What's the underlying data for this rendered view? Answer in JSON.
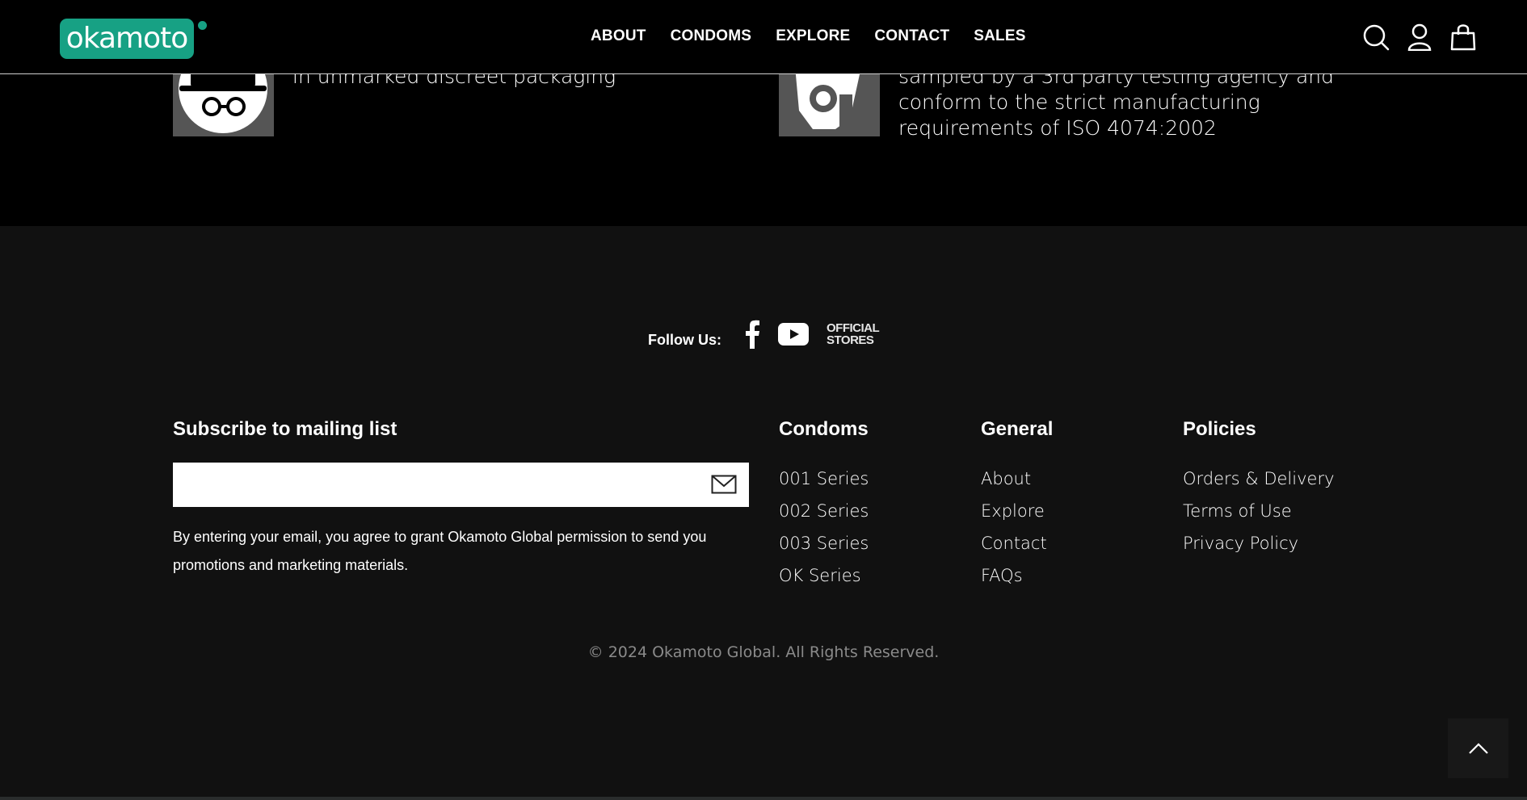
{
  "header": {
    "logo_text": "okamoto",
    "nav": [
      "ABOUT",
      "CONDOMS",
      "EXPLORE",
      "CONTACT",
      "SALES"
    ],
    "icons": [
      "search-icon",
      "account-icon",
      "cart-icon"
    ]
  },
  "features": [
    {
      "icon": "incognito-icon",
      "text": "in unmarked discreet packaging"
    },
    {
      "icon": "certification-icon",
      "text": "sampled by a 3rd party testing agency and conform to the strict manufacturing requirements of ISO 4074:2002"
    }
  ],
  "follow": {
    "label": "Follow Us:",
    "icons": [
      "facebook-icon",
      "youtube-icon"
    ],
    "official_line1": "OFFICIAL",
    "official_line2": "STORES"
  },
  "subscribe": {
    "title": "Subscribe to mailing list",
    "input_value": "",
    "note": "By entering your email, you agree to grant Okamoto Global permission to send you promotions and marketing materials."
  },
  "columns": {
    "condoms": {
      "title": "Condoms",
      "links": [
        "001 Series",
        "002 Series",
        "003 Series",
        "OK Series"
      ]
    },
    "general": {
      "title": "General",
      "links": [
        "About",
        "Explore",
        "Contact",
        "FAQs"
      ]
    },
    "policies": {
      "title": "Policies",
      "links": [
        "Orders & Delivery",
        "Terms of Use",
        "Privacy Policy"
      ]
    }
  },
  "copyright": "© 2024 Okamoto Global. All Rights Reserved.",
  "colors": {
    "brand": "#17a184",
    "header_bg": "#000000",
    "footer_bg": "#111111",
    "copyright": "#8a8a8a"
  }
}
